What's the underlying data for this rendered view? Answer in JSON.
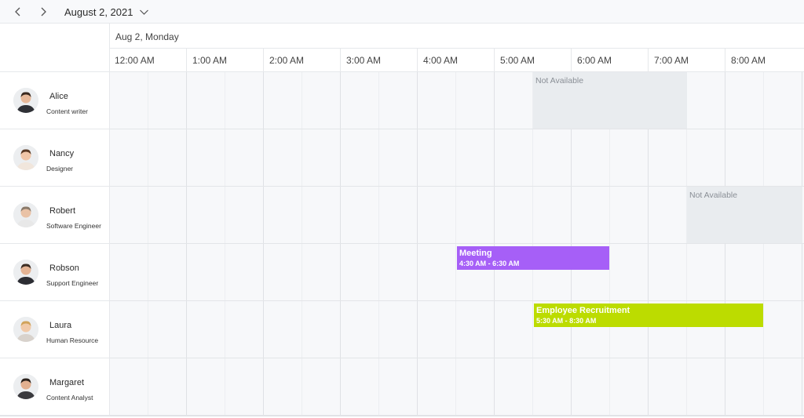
{
  "toolbar": {
    "prev_icon": "chevron-left-icon",
    "next_icon": "chevron-right-icon",
    "date_label": "August 2, 2021",
    "dropdown_icon": "chevron-down-icon"
  },
  "header": {
    "date_label": "Aug 2, Monday",
    "times": [
      "12:00 AM",
      "1:00 AM",
      "2:00 AM",
      "3:00 AM",
      "4:00 AM",
      "5:00 AM",
      "6:00 AM",
      "7:00 AM",
      "8:00 AM"
    ]
  },
  "resources": [
    {
      "name": "Alice",
      "role": "Content writer"
    },
    {
      "name": "Nancy",
      "role": "Designer"
    },
    {
      "name": "Robert",
      "role": "Software Engineer"
    },
    {
      "name": "Robson",
      "role": "Support Engineer"
    },
    {
      "name": "Laura",
      "role": "Human Resource"
    },
    {
      "name": "Margaret",
      "role": "Content Analyst"
    }
  ],
  "blocks": [
    {
      "resource": 0,
      "label": "Not Available",
      "start_hour": 5.5,
      "end_hour": 7.5
    },
    {
      "resource": 2,
      "label": "Not Available",
      "start_hour": 7.5,
      "end_hour": 9.0
    }
  ],
  "appointments": [
    {
      "resource": 3,
      "title": "Meeting",
      "time": "4:30 AM - 6:30 AM",
      "start_hour": 4.5,
      "end_hour": 6.5,
      "color": "#a65ff7"
    },
    {
      "resource": 4,
      "title": "Employee Recruitment",
      "time": "5:30 AM - 8:30 AM",
      "start_hour": 5.5,
      "end_hour": 8.5,
      "color": "#bcdc00"
    }
  ],
  "colors": {
    "grid_background": "#f7f8fa",
    "blocked": "#e9ecef",
    "border": "#e6e8eb"
  }
}
